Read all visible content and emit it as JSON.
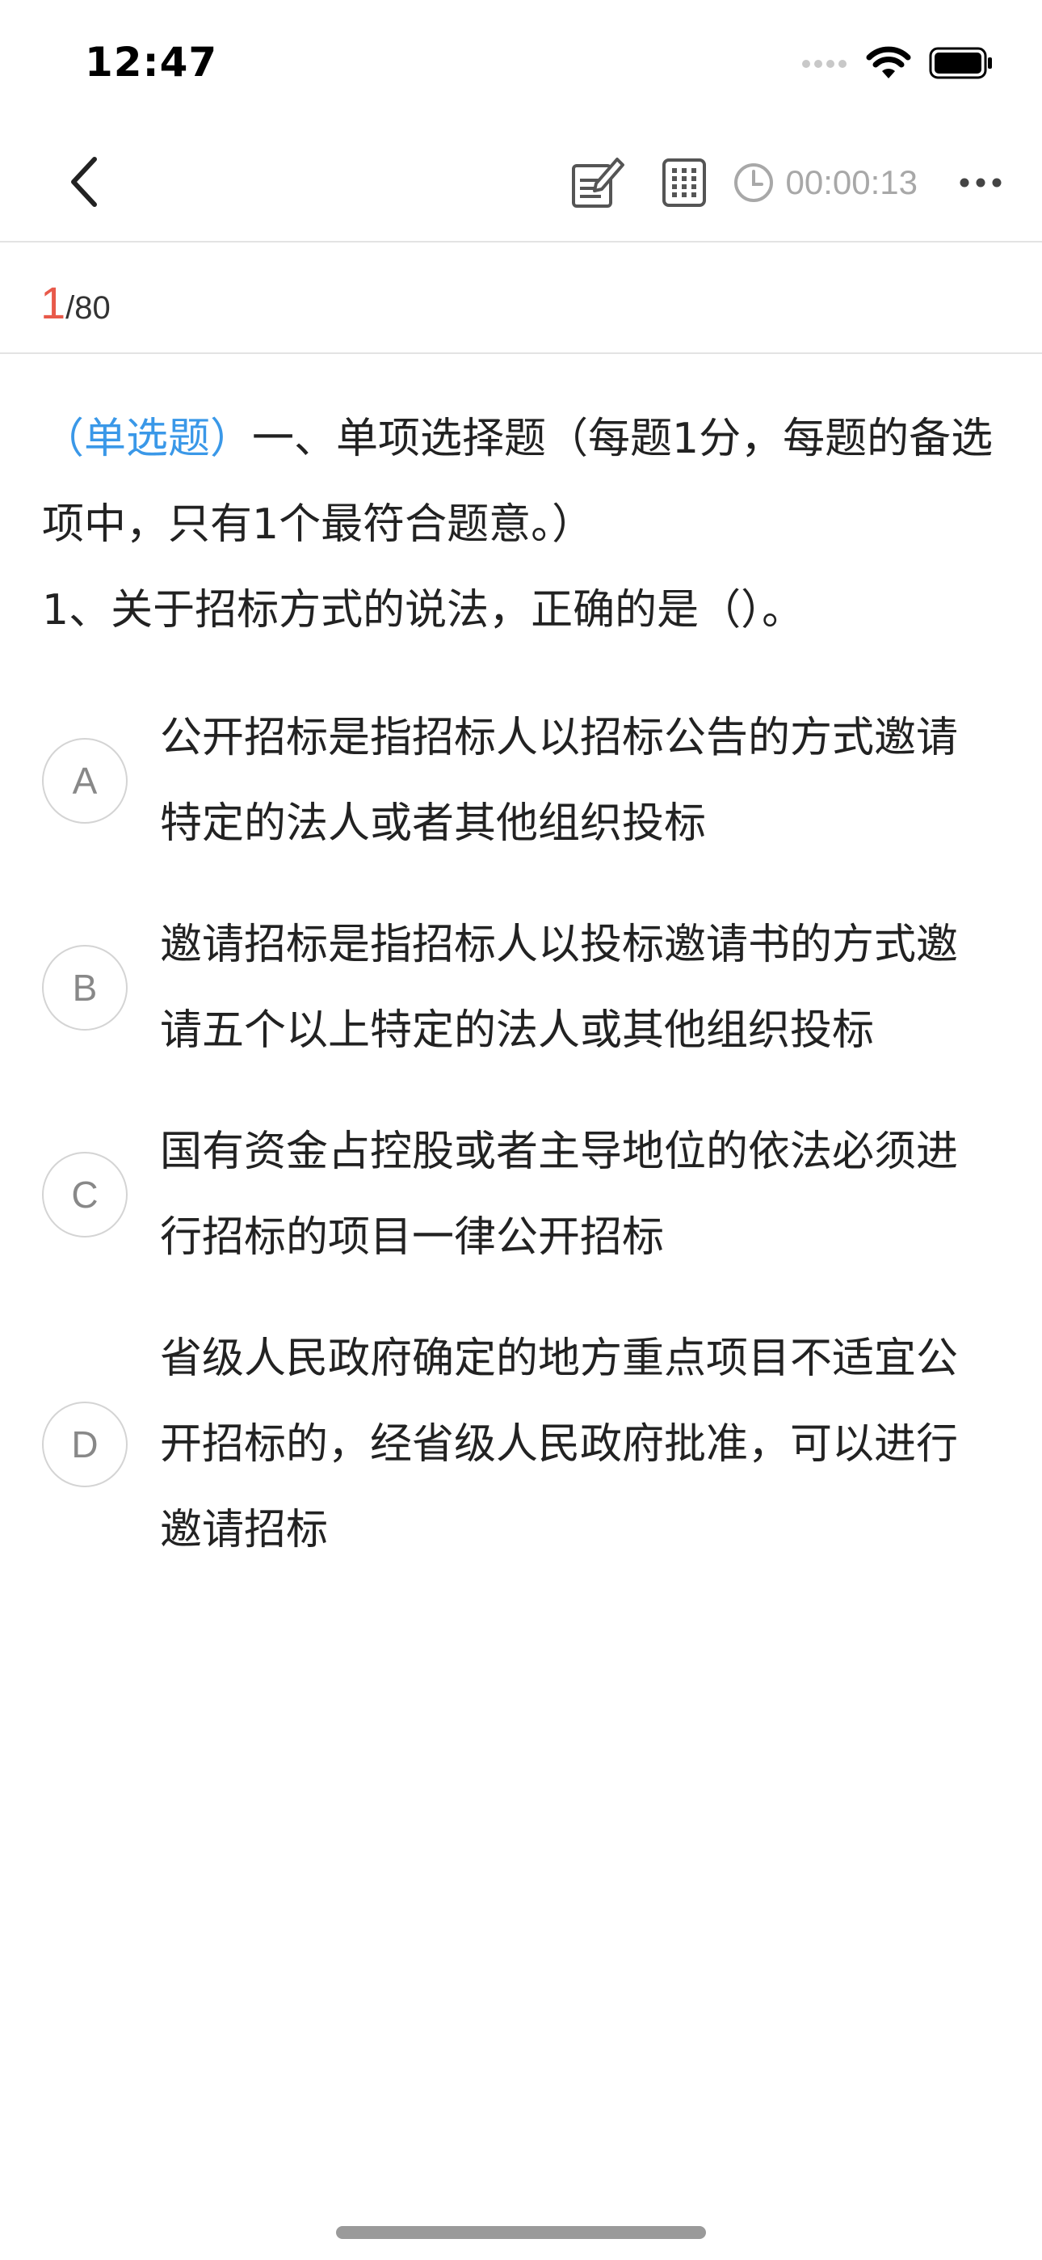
{
  "status_bar": {
    "time": "12:47",
    "icons": [
      "signal-dots-icon",
      "wifi-icon",
      "battery-icon"
    ]
  },
  "nav": {
    "icons": [
      "chevron-left-icon",
      "notes-edit-icon",
      "answer-sheet-grid-icon",
      "clock-icon",
      "more-dots-icon"
    ],
    "timer": "00:00:13"
  },
  "progress": {
    "current": "1",
    "total": "/80"
  },
  "question": {
    "type": "（单选题）",
    "section": "一、单项选择题（每题1分，每题的备选项中，只有1个最符合题意。）",
    "stem": "1、关于招标方式的说法，正确的是（）。"
  },
  "options": [
    {
      "letter": "A",
      "text": "公开招标是指招标人以招标公告的方式邀请特定的法人或者其他组织投标"
    },
    {
      "letter": "B",
      "text": "邀请招标是指招标人以投标邀请书的方式邀请五个以上特定的法人或其他组织投标"
    },
    {
      "letter": "C",
      "text": "国有资金占控股或者主导地位的依法必须进行招标的项目一律公开招标"
    },
    {
      "letter": "D",
      "text": "省级人民政府确定的地方重点项目不适宜公开招标的，经省级人民政府批准，可以进行邀请招标"
    }
  ],
  "colors": {
    "accent_blue": "#3a98e8",
    "progress_red": "#e8594a",
    "muted_gray": "#a8a8a8"
  }
}
